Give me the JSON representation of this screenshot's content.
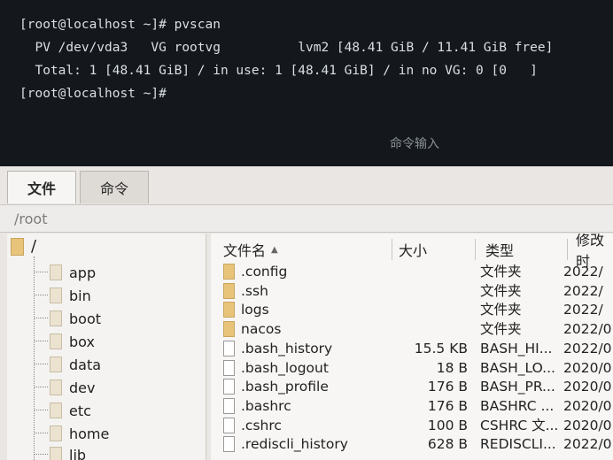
{
  "terminal": {
    "lines": [
      "[root@localhost ~]# pvscan",
      "  PV /dev/vda3   VG rootvg          lvm2 [48.41 GiB / 11.41 GiB free]",
      "  Total: 1 [48.41 GiB] / in use: 1 [48.41 GiB] / in no VG: 0 [0   ]",
      "[root@localhost ~]#"
    ],
    "command_input_placeholder": "命令输入"
  },
  "tabs": [
    {
      "label": "文件",
      "active": true
    },
    {
      "label": "命令",
      "active": false
    }
  ],
  "path": "/root",
  "tree": {
    "root": "/",
    "items": [
      "app",
      "bin",
      "boot",
      "box",
      "data",
      "dev",
      "etc",
      "home",
      "lib"
    ]
  },
  "file_list": {
    "columns": [
      "文件名",
      "大小",
      "类型",
      "修改时"
    ],
    "rows": [
      {
        "name": ".config",
        "size": "",
        "type": "文件夹",
        "modified": "2022/",
        "kind": "folder"
      },
      {
        "name": ".ssh",
        "size": "",
        "type": "文件夹",
        "modified": "2022/",
        "kind": "folder"
      },
      {
        "name": "logs",
        "size": "",
        "type": "文件夹",
        "modified": "2022/",
        "kind": "folder"
      },
      {
        "name": "nacos",
        "size": "",
        "type": "文件夹",
        "modified": "2022/0",
        "kind": "folder"
      },
      {
        "name": ".bash_history",
        "size": "15.5 KB",
        "type": "BASH_HI...",
        "modified": "2022/0",
        "kind": "file"
      },
      {
        "name": ".bash_logout",
        "size": "18 B",
        "type": "BASH_LO...",
        "modified": "2020/0",
        "kind": "file"
      },
      {
        "name": ".bash_profile",
        "size": "176 B",
        "type": "BASH_PR...",
        "modified": "2020/0",
        "kind": "file"
      },
      {
        "name": ".bashrc",
        "size": "176 B",
        "type": "BASHRC ...",
        "modified": "2020/0",
        "kind": "file"
      },
      {
        "name": ".cshrc",
        "size": "100 B",
        "type": "CSHRC 文...",
        "modified": "2020/0",
        "kind": "file"
      },
      {
        "name": ".rediscli_history",
        "size": "628 B",
        "type": "REDISCLI...",
        "modified": "2022/0",
        "kind": "file"
      }
    ]
  }
}
